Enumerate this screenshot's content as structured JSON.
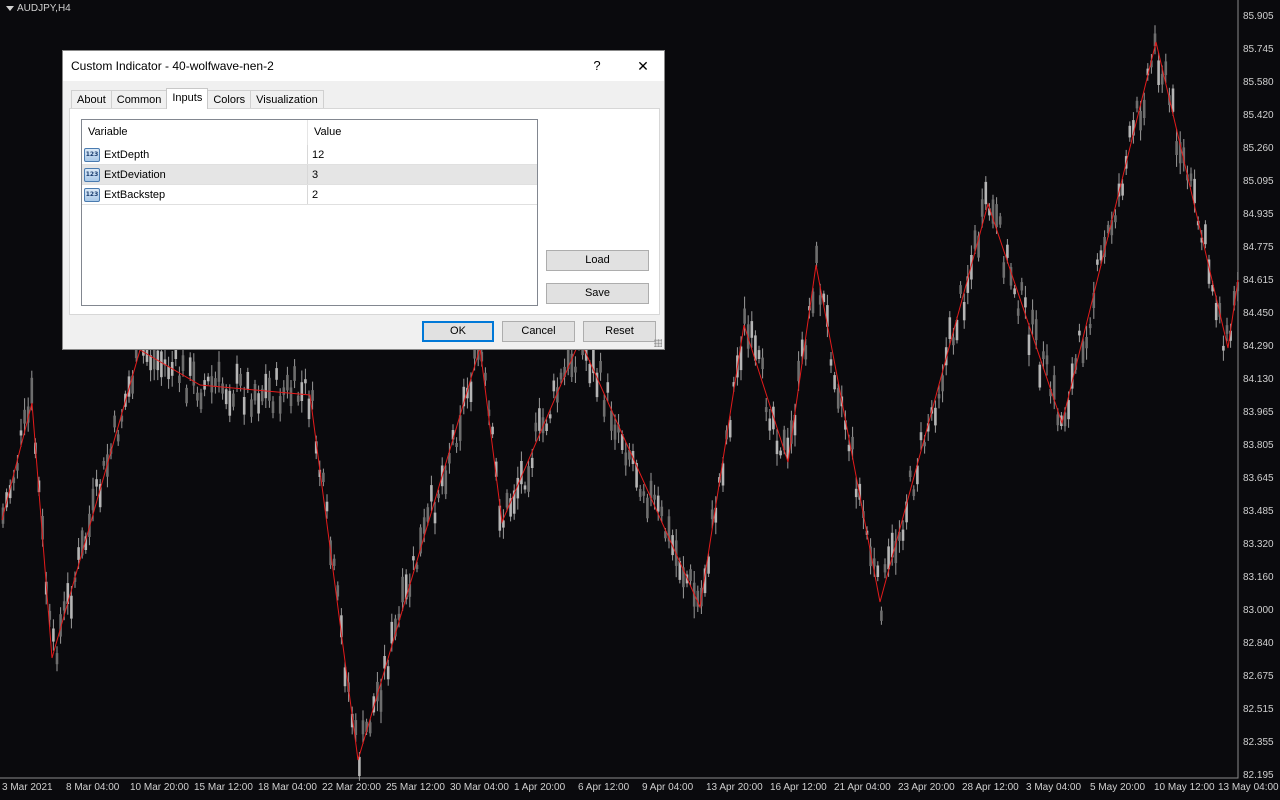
{
  "chart": {
    "symbol": "AUDJPY,H4",
    "price_labels": [
      "85.905",
      "85.745",
      "85.580",
      "85.420",
      "85.260",
      "85.095",
      "84.935",
      "84.775",
      "84.615",
      "84.450",
      "84.290",
      "84.130",
      "83.965",
      "83.805",
      "83.645",
      "83.485",
      "83.320",
      "83.160",
      "83.000",
      "82.840",
      "82.675",
      "82.515",
      "82.355",
      "82.195"
    ],
    "time_labels": [
      "3 Mar 2021",
      "8 Mar 04:00",
      "10 Mar 20:00",
      "15 Mar 12:00",
      "18 Mar 04:00",
      "22 Mar 20:00",
      "25 Mar 12:00",
      "30 Mar 04:00",
      "1 Apr 20:00",
      "6 Apr 12:00",
      "9 Apr 04:00",
      "13 Apr 20:00",
      "16 Apr 12:00",
      "21 Apr 04:00",
      "23 Apr 20:00",
      "28 Apr 12:00",
      "3 May 04:00",
      "5 May 20:00",
      "10 May 12:00",
      "13 May 04:00"
    ],
    "zigzag_color": "#e31b1b",
    "candle_color": "#9a9a9a",
    "background": "#0a0a0d"
  },
  "dialog": {
    "title": "Custom Indicator - 40-wolfwave-nen-2",
    "help": "?",
    "close": "✕",
    "tabs": [
      {
        "label": "About"
      },
      {
        "label": "Common"
      },
      {
        "label": "Inputs"
      },
      {
        "label": "Colors"
      },
      {
        "label": "Visualization"
      }
    ],
    "active_tab": "Inputs",
    "grid": {
      "col_variable": "Variable",
      "col_value": "Value",
      "rows": [
        {
          "name": "ExtDepth",
          "value": "12"
        },
        {
          "name": "ExtDeviation",
          "value": "3"
        },
        {
          "name": "ExtBackstep",
          "value": "2"
        }
      ],
      "icon_text": "123"
    },
    "load": "Load",
    "save": "Save",
    "ok": "OK",
    "cancel": "Cancel",
    "reset": "Reset"
  }
}
